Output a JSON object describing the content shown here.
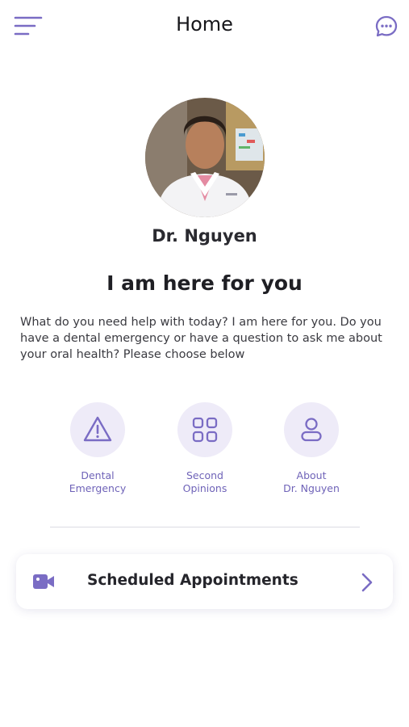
{
  "header": {
    "title": "Home",
    "menu_icon": "hamburger-menu-icon",
    "chat_icon": "chat-bubble-icon"
  },
  "profile": {
    "name": "Dr. Nguyen",
    "photo": "doctor-photo"
  },
  "main": {
    "headline": "I am here for you",
    "description": "What do you need help with today? I am here for you. Do you have a dental emergency or have a question to ask me about your oral health? Please choose below"
  },
  "options": [
    {
      "line1": "Dental",
      "line2": "Emergency",
      "icon": "warning-triangle-icon"
    },
    {
      "line1": "Second",
      "line2": "Opinions",
      "icon": "grid-icon"
    },
    {
      "line1": "About",
      "line2": "Dr. Nguyen",
      "icon": "person-icon"
    }
  ],
  "appointments": {
    "label": "Scheduled Appointments",
    "icon": "video-camera-icon",
    "chevron": "chevron-right-icon"
  },
  "colors": {
    "accent": "#7a6cc4",
    "accent_light": "#eeebf8",
    "text_dark": "#1f1f24"
  }
}
